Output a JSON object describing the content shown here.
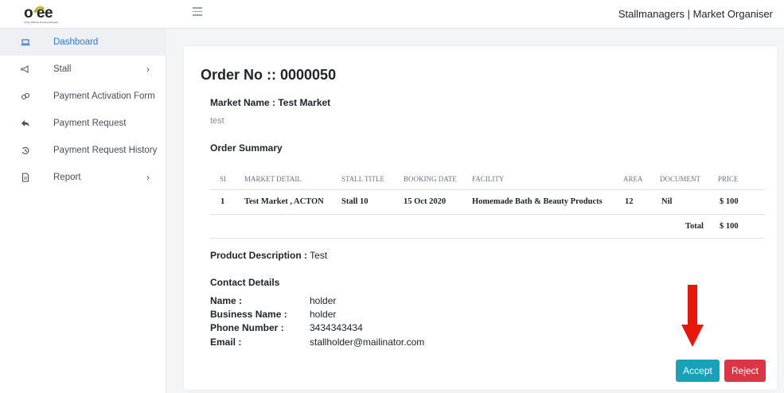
{
  "header": {
    "logo_text": "o ee",
    "logo_tagline": "Outer Markets Vending Manager",
    "user_label": "Stallmanagers | Market Organiser"
  },
  "sidebar": {
    "items": [
      {
        "label": "Dashboard",
        "icon": "laptop-icon",
        "active": true
      },
      {
        "label": "Stall",
        "icon": "megaphone-icon",
        "has_submenu": true
      },
      {
        "label": "Payment Activation Form",
        "icon": "link-icon"
      },
      {
        "label": "Payment Request",
        "icon": "reply-icon"
      },
      {
        "label": "Payment Request History",
        "icon": "history-icon"
      },
      {
        "label": "Report",
        "icon": "file-icon",
        "has_submenu": true
      }
    ]
  },
  "order": {
    "title": "Order No :: 0000050",
    "market_name_label": "Market Name : Test Market",
    "market_note": "test",
    "summary_title": "Order Summary",
    "table": {
      "headers": [
        "SI",
        "MARKET DETAIL",
        "STALL TITLE",
        "BOOKING DATE",
        "FACILITY",
        "AREA",
        "DOCUMENT",
        "PRICE"
      ],
      "rows": [
        {
          "si": "1",
          "market_detail": "Test Market , ACTON",
          "stall_title": "Stall 10",
          "booking_date": "15 Oct 2020",
          "facility": "Homemade Bath & Beauty Products",
          "area": "12",
          "document": "Nil",
          "price": "$ 100"
        }
      ],
      "total_label": "Total",
      "total_value": "$ 100"
    },
    "product_description_label": "Product Description :",
    "product_description_value": "Test",
    "contact_title": "Contact Details",
    "contact": {
      "name_label": "Name :",
      "name_value": "holder",
      "business_label": "Business Name :",
      "business_value": "holder",
      "phone_label": "Phone Number :",
      "phone_value": "3434343434",
      "email_label": "Email :",
      "email_value": "stallholder@mailinator.com"
    },
    "accept_label": "Accept",
    "reject_label": "Reject"
  },
  "colors": {
    "accent": "#2a7ad8",
    "accept": "#17a2b8",
    "reject": "#dc3545",
    "annotation_arrow": "#e8170b"
  }
}
